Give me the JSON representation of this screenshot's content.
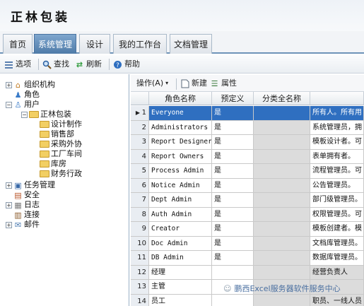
{
  "app": {
    "title": "正林包装"
  },
  "tabs": [
    {
      "label": "首页",
      "active": false
    },
    {
      "label": "系统管理",
      "active": true
    },
    {
      "label": "设计",
      "active": false
    },
    {
      "label": "我的工作台",
      "active": false
    },
    {
      "label": "文档管理",
      "active": false
    }
  ],
  "toolbar": {
    "options": "选项",
    "find": "查找",
    "refresh": "刷新",
    "help": "帮助"
  },
  "tree": {
    "org": "组织机构",
    "role": "角色",
    "user": "用户",
    "company": "正林包装",
    "departments": [
      "设计制作",
      "销售部",
      "采购外协",
      "工厂车间",
      "库房",
      "财务行政"
    ],
    "task": "任务管理",
    "security": "安全",
    "log": "日志",
    "connect": "连接",
    "mail": "邮件"
  },
  "grid_toolbar": {
    "action": "操作(A)",
    "new": "新建",
    "props": "属性"
  },
  "grid": {
    "columns": [
      "角色名称",
      "预定义",
      "分类全名称",
      ""
    ],
    "rows": [
      {
        "no": "1",
        "name": "Everyone",
        "predef": "是",
        "cat": "",
        "desc": "所有人。所有用"
      },
      {
        "no": "2",
        "name": "Administrators",
        "predef": "是",
        "cat": "",
        "desc": "系统管理员，拥"
      },
      {
        "no": "3",
        "name": "Report Designers",
        "predef": "是",
        "cat": "",
        "desc": "模板设计者。可"
      },
      {
        "no": "4",
        "name": "Report Owners",
        "predef": "是",
        "cat": "",
        "desc": "表单拥有者。"
      },
      {
        "no": "5",
        "name": "Process Admin",
        "predef": "是",
        "cat": "",
        "desc": "流程管理员。可"
      },
      {
        "no": "6",
        "name": "Notice Admin",
        "predef": "是",
        "cat": "",
        "desc": "公告管理员。"
      },
      {
        "no": "7",
        "name": "Dept Admin",
        "predef": "是",
        "cat": "",
        "desc": "部门级管理员。"
      },
      {
        "no": "8",
        "name": "Auth Admin",
        "predef": "是",
        "cat": "",
        "desc": "权限管理员。可"
      },
      {
        "no": "9",
        "name": "Creator",
        "predef": "是",
        "cat": "",
        "desc": "模板创建者。模"
      },
      {
        "no": "10",
        "name": "Doc Admin",
        "predef": "是",
        "cat": "",
        "desc": "文档库管理员。"
      },
      {
        "no": "11",
        "name": "DB Admin",
        "predef": "是",
        "cat": "",
        "desc": "数据库管理员。"
      },
      {
        "no": "12",
        "name": "经理",
        "predef": "",
        "cat": "",
        "desc": "经营负责人"
      },
      {
        "no": "13",
        "name": "主管",
        "predef": "",
        "cat": "",
        "desc": ""
      },
      {
        "no": "14",
        "name": "员工",
        "predef": "",
        "cat": "",
        "desc": "职员、一线人员"
      }
    ]
  },
  "watermark": "鹏西Excel服务器软件服务中心",
  "colors": {
    "accent": "#4f7ba8",
    "selection": "#2f6fc0",
    "grid_gray": "#dcdcdc"
  }
}
